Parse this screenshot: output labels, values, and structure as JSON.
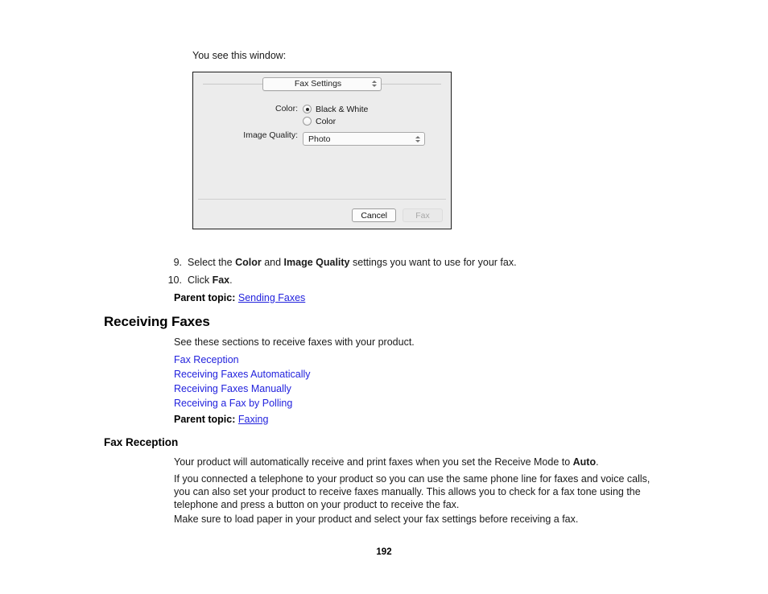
{
  "intro": {
    "line": "You see this window:"
  },
  "dialog": {
    "popup_value": "Fax Settings",
    "color_label": "Color:",
    "radio_bw": "Black & White",
    "radio_color": "Color",
    "image_quality_label": "Image Quality:",
    "image_quality_value": "Photo",
    "cancel_label": "Cancel",
    "fax_label": "Fax",
    "selected_color_option": "Black & White",
    "fax_button_state": "disabled"
  },
  "steps": [
    {
      "number": "9.",
      "prefix": "Select the ",
      "bold1": "Color",
      "middle": " and ",
      "bold2": "Image Quality",
      "suffix": " settings you want to use for your fax."
    },
    {
      "number": "10.",
      "prefix": "Click ",
      "bold1": "Fax",
      "middle": "",
      "bold2": "",
      "suffix": "."
    }
  ],
  "parent_topic_sending": {
    "label": "Parent topic:",
    "link": "Sending Faxes"
  },
  "receiving_faxes": {
    "heading": "Receiving Faxes",
    "intro": "See these sections to receive faxes with your product.",
    "links": [
      "Fax Reception",
      "Receiving Faxes Automatically",
      "Receiving Faxes Manually",
      "Receiving a Fax by Polling"
    ],
    "parent_label": "Parent topic:",
    "parent_link": "Faxing"
  },
  "fax_reception": {
    "heading": "Fax Reception",
    "para1_prefix": "Your product will automatically receive and print faxes when you set the Receive Mode to ",
    "para1_bold": "Auto",
    "para1_suffix": ".",
    "para2": "If you connected a telephone to your product so you can use the same phone line for faxes and voice calls, you can also set your product to receive faxes manually. This allows you to check for a fax tone using the telephone and press a button on your product to receive the fax.",
    "para3": "Make sure to load paper in your product and select your fax settings before receiving a fax."
  },
  "footer": {
    "page_number": "192"
  },
  "colors": {
    "link": "#2222dd",
    "dialog_background": "#ececec",
    "dialog_border": "#1c1c1c",
    "text": "#1a1a1a"
  }
}
